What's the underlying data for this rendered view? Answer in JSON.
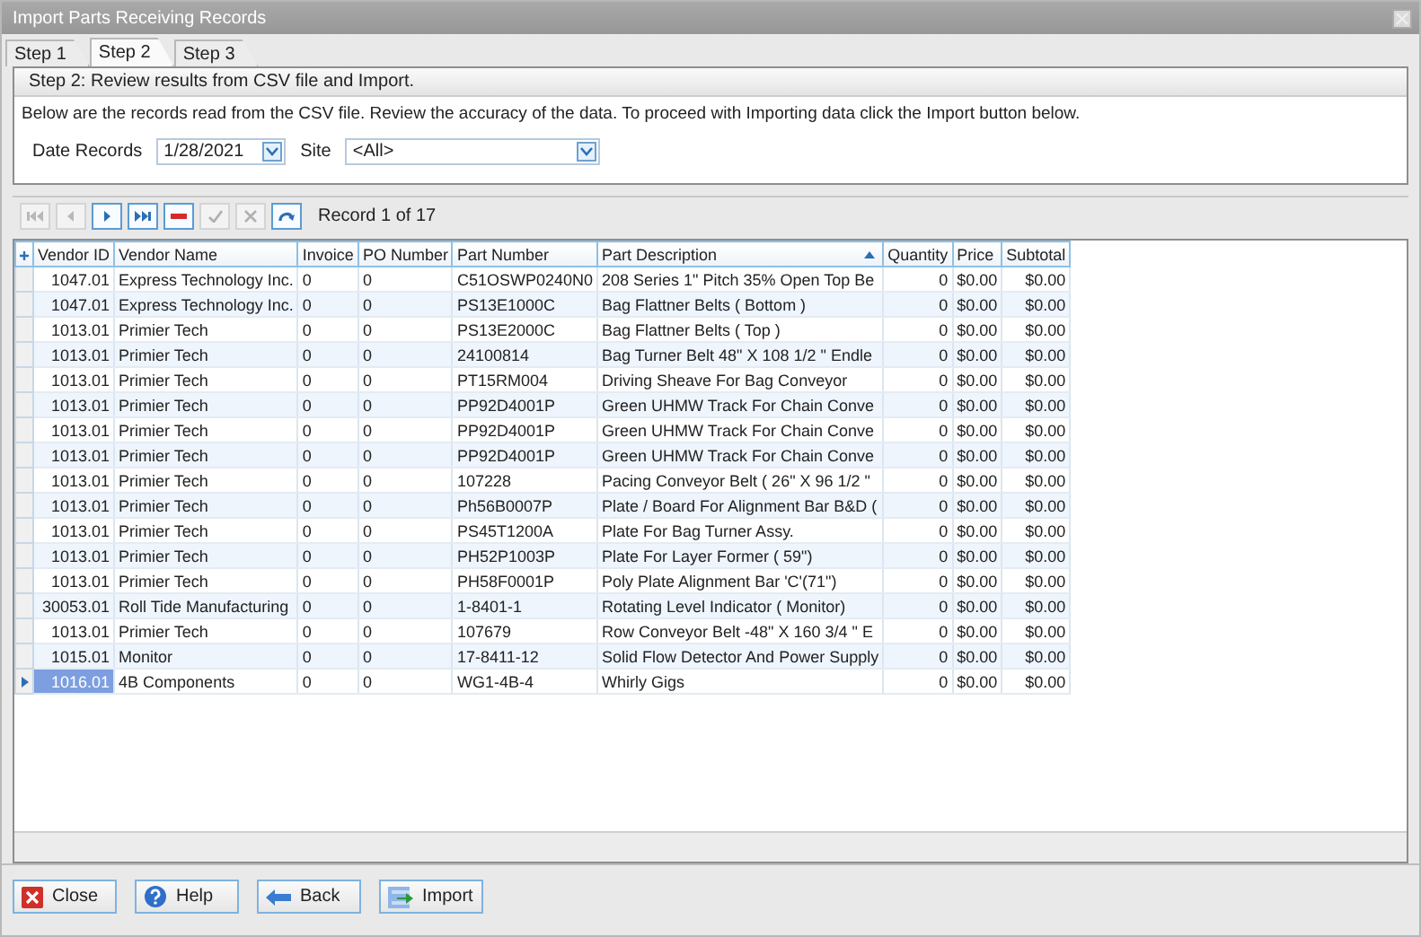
{
  "window": {
    "title": "Import Parts Receiving Records"
  },
  "tabs": [
    {
      "label": "Step 1",
      "selected": false
    },
    {
      "label": "Step 2",
      "selected": true
    },
    {
      "label": "Step 3",
      "selected": false
    }
  ],
  "step_header": "Step 2:  Review results from CSV file and Import.",
  "instructions": "Below are the records read from the CSV file.  Review the accuracy of the data. To proceed with Importing data click the Import button below.",
  "filters": [
    {
      "label": "Date Records",
      "value": "1/28/2021",
      "kind": "short"
    },
    {
      "label": "Site",
      "value": "<All>",
      "kind": "wide"
    }
  ],
  "navigator": {
    "buttons": [
      {
        "kind": "first",
        "disabled": true
      },
      {
        "kind": "prev",
        "disabled": true
      },
      {
        "kind": "next",
        "disabled": false
      },
      {
        "kind": "last",
        "disabled": false
      },
      {
        "kind": "delete",
        "disabled": false
      },
      {
        "kind": "save",
        "disabled": true
      },
      {
        "kind": "cancel",
        "disabled": true
      },
      {
        "kind": "refresh",
        "disabled": false
      }
    ],
    "status": "Record 1 of 17"
  },
  "table": {
    "columns": [
      {
        "label": "Vendor ID",
        "sorted": false
      },
      {
        "label": "Vendor Name",
        "sorted": false
      },
      {
        "label": "Invoice",
        "sorted": false
      },
      {
        "label": "PO Number",
        "sorted": false
      },
      {
        "label": "Part Number",
        "sorted": false
      },
      {
        "label": "Part Description",
        "sorted": true
      },
      {
        "label": "Quantity",
        "sorted": false
      },
      {
        "label": "Price",
        "sorted": false
      },
      {
        "label": "Subtotal",
        "sorted": false
      }
    ],
    "rows": [
      {
        "selected": false,
        "cells": [
          "1047.01",
          "Express Technology Inc.",
          "0",
          "0",
          "C51OSWP0240N0",
          "208 Series 1\" Pitch 35% Open Top Be",
          "0",
          "$0.00",
          "$0.00"
        ]
      },
      {
        "selected": false,
        "cells": [
          "1047.01",
          "Express Technology Inc.",
          "0",
          "0",
          "PS13E1000C",
          "Bag Flattner Belts ( Bottom )",
          "0",
          "$0.00",
          "$0.00"
        ]
      },
      {
        "selected": false,
        "cells": [
          "1013.01",
          "Primier Tech",
          "0",
          "0",
          "PS13E2000C",
          "Bag Flattner Belts ( Top )",
          "0",
          "$0.00",
          "$0.00"
        ]
      },
      {
        "selected": false,
        "cells": [
          "1013.01",
          "Primier Tech",
          "0",
          "0",
          "24100814",
          "Bag Turner Belt 48\" X 108 1/2 \" Endle",
          "0",
          "$0.00",
          "$0.00"
        ]
      },
      {
        "selected": false,
        "cells": [
          "1013.01",
          "Primier Tech",
          "0",
          "0",
          "PT15RM004",
          "Driving Sheave For Bag Conveyor",
          "0",
          "$0.00",
          "$0.00"
        ]
      },
      {
        "selected": false,
        "cells": [
          "1013.01",
          "Primier Tech",
          "0",
          "0",
          "PP92D4001P",
          "Green UHMW Track For Chain Conve",
          "0",
          "$0.00",
          "$0.00"
        ]
      },
      {
        "selected": false,
        "cells": [
          "1013.01",
          "Primier Tech",
          "0",
          "0",
          "PP92D4001P",
          "Green UHMW Track For Chain Conve",
          "0",
          "$0.00",
          "$0.00"
        ]
      },
      {
        "selected": false,
        "cells": [
          "1013.01",
          "Primier Tech",
          "0",
          "0",
          "PP92D4001P",
          "Green UHMW Track For Chain Conve",
          "0",
          "$0.00",
          "$0.00"
        ]
      },
      {
        "selected": false,
        "cells": [
          "1013.01",
          "Primier Tech",
          "0",
          "0",
          "107228",
          "Pacing Conveyor Belt ( 26\" X 96 1/2 \"",
          "0",
          "$0.00",
          "$0.00"
        ]
      },
      {
        "selected": false,
        "cells": [
          "1013.01",
          "Primier Tech",
          "0",
          "0",
          "Ph56B0007P",
          "Plate / Board For Alignment Bar B&D (",
          "0",
          "$0.00",
          "$0.00"
        ]
      },
      {
        "selected": false,
        "cells": [
          "1013.01",
          "Primier Tech",
          "0",
          "0",
          "PS45T1200A",
          "Plate For Bag Turner Assy.",
          "0",
          "$0.00",
          "$0.00"
        ]
      },
      {
        "selected": false,
        "cells": [
          "1013.01",
          "Primier Tech",
          "0",
          "0",
          "PH52P1003P",
          "Plate For Layer Former ( 59\")",
          "0",
          "$0.00",
          "$0.00"
        ]
      },
      {
        "selected": false,
        "cells": [
          "1013.01",
          "Primier Tech",
          "0",
          "0",
          "PH58F0001P",
          "Poly Plate Alignment Bar 'C'(71\")",
          "0",
          "$0.00",
          "$0.00"
        ]
      },
      {
        "selected": false,
        "cells": [
          "30053.01",
          "Roll Tide Manufacturing",
          "0",
          "0",
          "1-8401-1",
          "Rotating Level Indicator ( Monitor)",
          "0",
          "$0.00",
          "$0.00"
        ]
      },
      {
        "selected": false,
        "cells": [
          "1013.01",
          "Primier Tech",
          "0",
          "0",
          "107679",
          "Row Conveyor Belt -48\" X 160 3/4 \" E",
          "0",
          "$0.00",
          "$0.00"
        ]
      },
      {
        "selected": false,
        "cells": [
          "1015.01",
          "Monitor",
          "0",
          "0",
          "17-8411-12",
          "Solid Flow Detector And Power Supply",
          "0",
          "$0.00",
          "$0.00"
        ]
      },
      {
        "selected": true,
        "cells": [
          "1016.01",
          "4B Components",
          "0",
          "0",
          "WG1-4B-4",
          "Whirly Gigs",
          "0",
          "$0.00",
          "$0.00"
        ]
      }
    ]
  },
  "buttons": [
    {
      "label": "Close",
      "kind": "close"
    },
    {
      "label": "Help",
      "kind": "help"
    },
    {
      "label": "Back",
      "kind": "back"
    },
    {
      "label": "Import",
      "kind": "import"
    }
  ]
}
